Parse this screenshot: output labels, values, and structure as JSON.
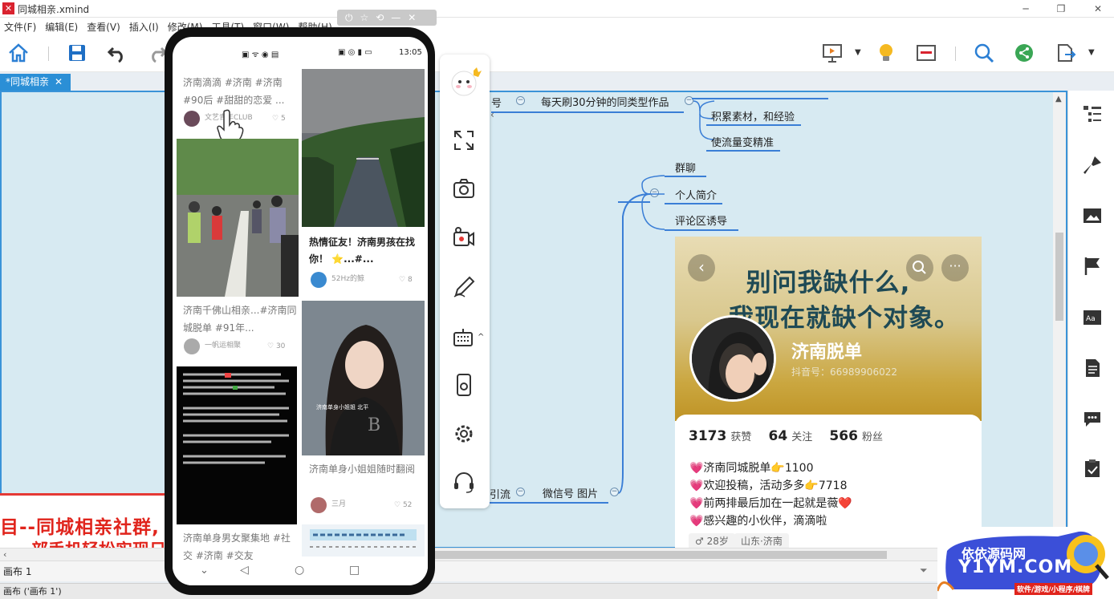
{
  "window": {
    "title": "同城相亲.xmind"
  },
  "menu": [
    "文件(F)",
    "编辑(E)",
    "查看(V)",
    "插入(I)",
    "修改(M)",
    "工具(T)",
    "窗口(W)",
    "帮助(H)"
  ],
  "tab": {
    "label": "*同城相亲",
    "close": "✕"
  },
  "mindmap": {
    "left_partial": "号",
    "branch1": "每天刷30分钟的同类型作品",
    "branch1_children": [
      "积累素材，和经验",
      "使流量变精准"
    ],
    "branch2_children": [
      "群聊",
      "个人简介",
      "评论区诱导"
    ],
    "left_partial2": "引流",
    "branch3": "微信号 图片"
  },
  "red_banner": {
    "line1": "目--同城相亲社群,",
    "line2": "…部手机轻松实现日"
  },
  "phone": {
    "time": "13:05",
    "cards": [
      {
        "text": "济南滴滴 #济南 #济南 #90后 #甜甜的恋爱 ...",
        "author": "文艺青年CLUB",
        "likes": "5"
      },
      {
        "text": "热情征友！济南男孩在找你！ ⭐...#...",
        "author": "52Hz的鲸",
        "likes": "8"
      },
      {
        "text": "济南千佛山相亲...#济南同城脱单 #91年...",
        "author": "一帆运相聚",
        "likes": "30"
      },
      {
        "text": "济南单身小姐姐随时翻阅",
        "author": "三月",
        "likes": "52"
      },
      {
        "text": "济南单身男女聚集地 #社交 #济南 #交友",
        "author": "",
        "likes": ""
      }
    ],
    "photo_caption": "济南单身小姐姐 北平"
  },
  "profile": {
    "slogan1": "别问我缺什么,",
    "slogan2": "我现在就缺个对象。",
    "name": "济南脱单",
    "account": "抖音号：66989906022",
    "likes_num": "3173",
    "likes_lbl": "获赞",
    "follow_num": "64",
    "follow_lbl": "关注",
    "fans_num": "566",
    "fans_lbl": "粉丝",
    "bio": [
      "💗济南同城脱单👉1100",
      "💗欢迎投稿，活动多多👉7718",
      "💗前两排最后加在一起就是薇❤️",
      "💗感兴趣的小伙伴，滴滴啦"
    ],
    "tags": [
      "♂ 28岁",
      "山东·济南"
    ]
  },
  "sheet": {
    "tab": "画布 1"
  },
  "status": {
    "text": "画布 ('画布 1')"
  },
  "watermark": {
    "line1": "依依源码网",
    "line2": "Y1YM.COM",
    "line3": "软件/游戏/小程序/棋牌"
  },
  "colors": {
    "accent": "#2b8fd6",
    "canvas": "#d7eaf2",
    "branch": "#3a7ed6",
    "red": "#e0241c"
  }
}
